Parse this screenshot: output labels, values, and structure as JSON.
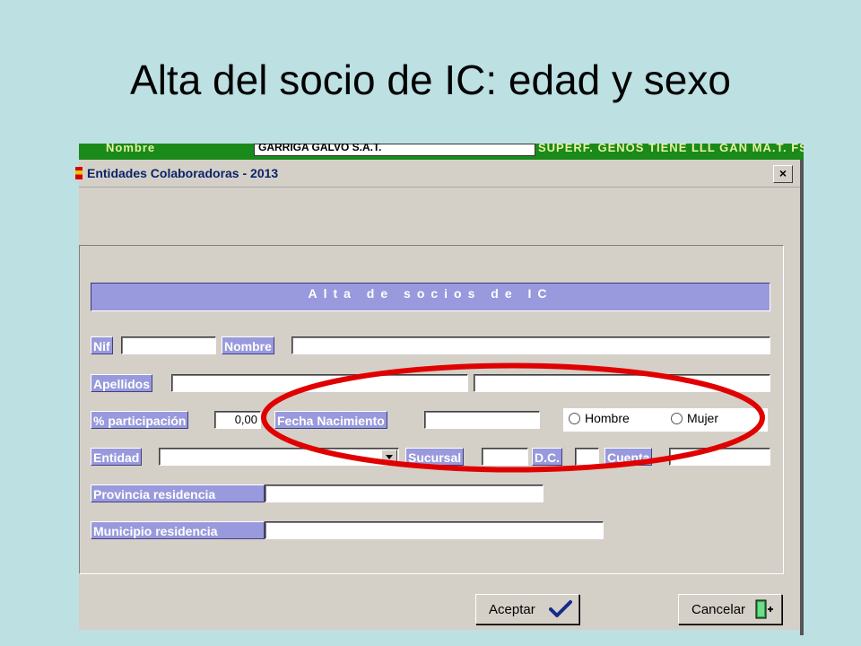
{
  "slide": {
    "title": "Alta del socio de IC: edad y sexo"
  },
  "background_app": {
    "left_text": "Nombre",
    "field_value": "GARRIGA GALVO S.A.T.",
    "right_text": "SUPERF. GENOS TIENE LLL GAN   MA.T.  FS"
  },
  "dialog": {
    "title": "Entidades Colaboradoras - 2013",
    "close_label": "×",
    "header": "Alta de socios de IC",
    "labels": {
      "nif": "Nif",
      "nombre": "Nombre",
      "apellidos": "Apellidos",
      "participacion": "% participación",
      "fecha_nacimiento": "Fecha Nacimiento",
      "entidad": "Entidad",
      "sucursal": "Sucursal",
      "dc": "D.C.",
      "cuenta": "Cuenta",
      "provincia": "Provincia residencia",
      "municipio": "Municipio residencia"
    },
    "values": {
      "nif": "",
      "nombre": "",
      "apellidos_1": "",
      "apellidos_2": "",
      "participacion": "0,00",
      "fecha_nacimiento": "",
      "entidad": "",
      "sucursal": "",
      "dc": "",
      "cuenta": "",
      "provincia": "",
      "municipio": ""
    },
    "sexo": {
      "options": [
        "Hombre",
        "Mujer"
      ],
      "selected": ""
    },
    "buttons": {
      "aceptar": "Aceptar",
      "cancelar": "Cancelar"
    }
  },
  "colors": {
    "slide_bg": "#bde0e3",
    "dialog_bg": "#d4d0c8",
    "label_bg": "#9999dd",
    "title_text": "#0a246a",
    "highlight": "#e00000",
    "check": "#1a2a8a"
  },
  "icons": {
    "aceptar": "checkmark-icon",
    "cancelar": "exit-door-icon",
    "close": "close-x-icon"
  }
}
